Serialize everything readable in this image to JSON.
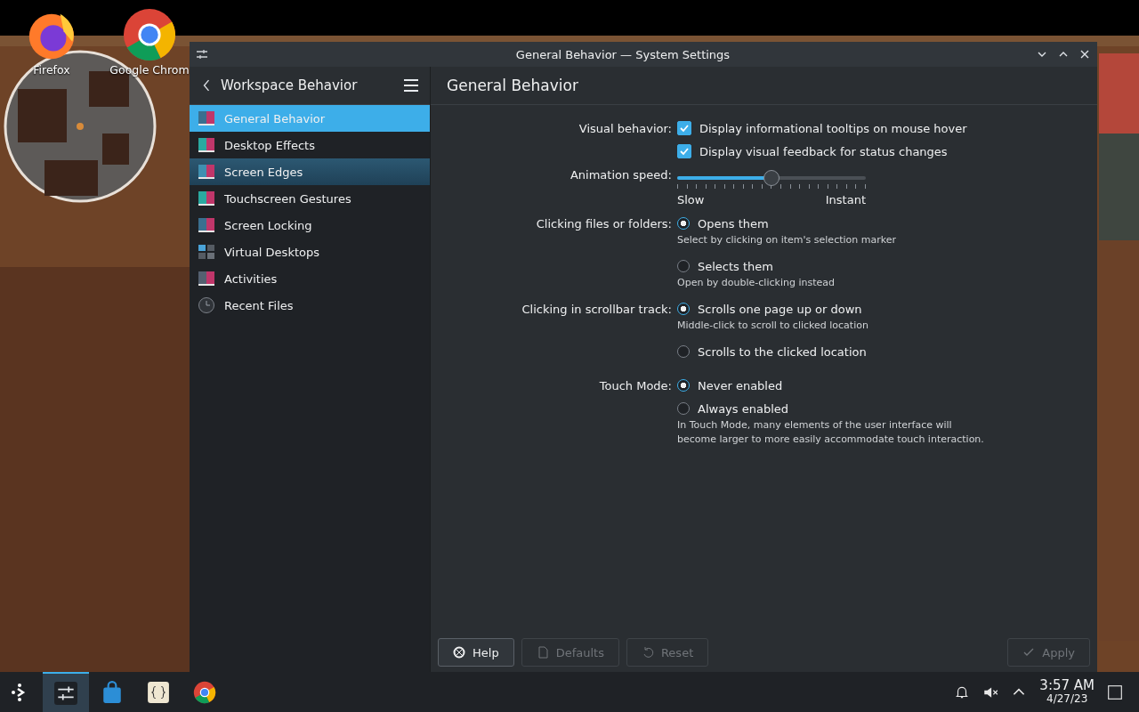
{
  "desktop_icons": [
    {
      "label": "Firefox"
    },
    {
      "label": "Google Chrom"
    }
  ],
  "window": {
    "title": "General Behavior — System Settings"
  },
  "sidebar": {
    "title": "Workspace Behavior",
    "items": [
      {
        "label": "General Behavior",
        "selected": true,
        "hovered": false
      },
      {
        "label": "Desktop Effects",
        "selected": false,
        "hovered": false
      },
      {
        "label": "Screen Edges",
        "selected": false,
        "hovered": true
      },
      {
        "label": "Touchscreen Gestures",
        "selected": false,
        "hovered": false
      },
      {
        "label": "Screen Locking",
        "selected": false,
        "hovered": false
      },
      {
        "label": "Virtual Desktops",
        "selected": false,
        "hovered": false
      },
      {
        "label": "Activities",
        "selected": false,
        "hovered": false
      },
      {
        "label": "Recent Files",
        "selected": false,
        "hovered": false
      }
    ]
  },
  "page": {
    "title": "General Behavior",
    "rows": [
      {
        "kind": "checkbox",
        "label": "Visual behavior:",
        "text": "Display informational tooltips on mouse hover",
        "checked": true
      },
      {
        "kind": "checkbox",
        "text": "Display visual feedback for status changes",
        "checked": true
      },
      {
        "kind": "slider",
        "label": "Animation speed:",
        "level": 0.5,
        "min_label": "Slow",
        "max_label": "Instant"
      },
      {
        "kind": "radio",
        "label": "Clicking files or folders:",
        "text": "Opens them",
        "selected": true,
        "hint": "Select by clicking on item's selection marker"
      },
      {
        "kind": "radio",
        "text": "Selects them",
        "selected": false,
        "hint": "Open by double-clicking instead"
      },
      {
        "kind": "radio",
        "label": "Clicking in scrollbar track:",
        "text": "Scrolls one page up or down",
        "selected": true,
        "hint": "Middle-click to scroll to clicked location"
      },
      {
        "kind": "radio",
        "text": "Scrolls to the clicked location",
        "selected": false
      },
      {
        "kind": "radio",
        "label": "Touch Mode:",
        "text": "Never enabled",
        "selected": true
      },
      {
        "kind": "radio",
        "text": "Always enabled",
        "selected": false,
        "hint": "In Touch Mode, many elements of the user interface will become larger to more easily accommodate touch interaction."
      }
    ]
  },
  "buttons": [
    {
      "label": "Help",
      "disabled": false
    },
    {
      "label": "Defaults",
      "disabled": true
    },
    {
      "label": "Reset",
      "disabled": true
    },
    {
      "label": "Apply",
      "disabled": true
    }
  ],
  "taskbar": {
    "tasks": [
      {
        "selected": true
      },
      {
        "selected": false
      },
      {
        "selected": false
      },
      {
        "selected": false
      }
    ],
    "time": "3:57 AM",
    "date": "4/27/23"
  }
}
